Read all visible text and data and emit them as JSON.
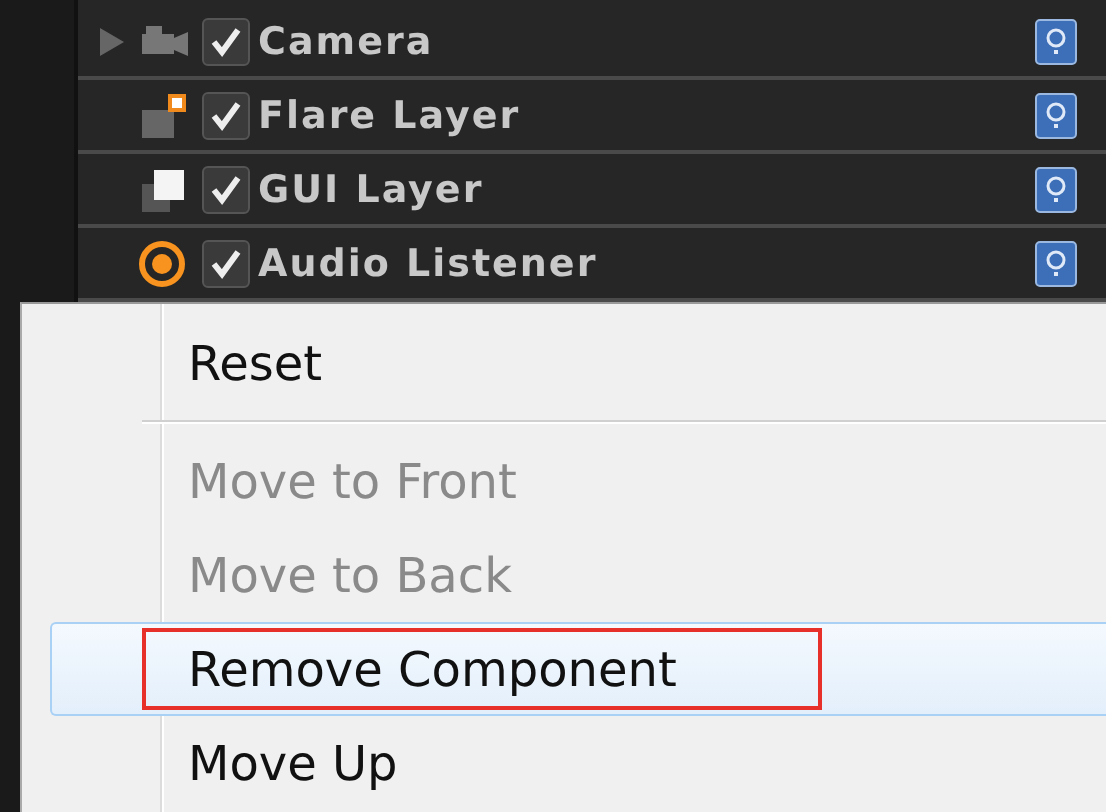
{
  "components": [
    {
      "kind": "camera",
      "name": "Camera",
      "enabled": true,
      "expandable": true
    },
    {
      "kind": "flare",
      "name": "Flare Layer",
      "enabled": true,
      "expandable": false
    },
    {
      "kind": "gui",
      "name": "GUI Layer",
      "enabled": true,
      "expandable": false
    },
    {
      "kind": "audio",
      "name": "Audio Listener",
      "enabled": true,
      "expandable": false
    }
  ],
  "context_menu": {
    "items": [
      {
        "kind": "item",
        "label": "Reset",
        "disabled": false,
        "selected": false,
        "annotated": false
      },
      {
        "kind": "separator"
      },
      {
        "kind": "item",
        "label": "Move to Front",
        "disabled": true,
        "selected": false,
        "annotated": false
      },
      {
        "kind": "item",
        "label": "Move to Back",
        "disabled": true,
        "selected": false,
        "annotated": false
      },
      {
        "kind": "item",
        "label": "Remove Component",
        "disabled": false,
        "selected": true,
        "annotated": true
      },
      {
        "kind": "item",
        "label": "Move Up",
        "disabled": false,
        "selected": false,
        "annotated": false
      }
    ]
  }
}
